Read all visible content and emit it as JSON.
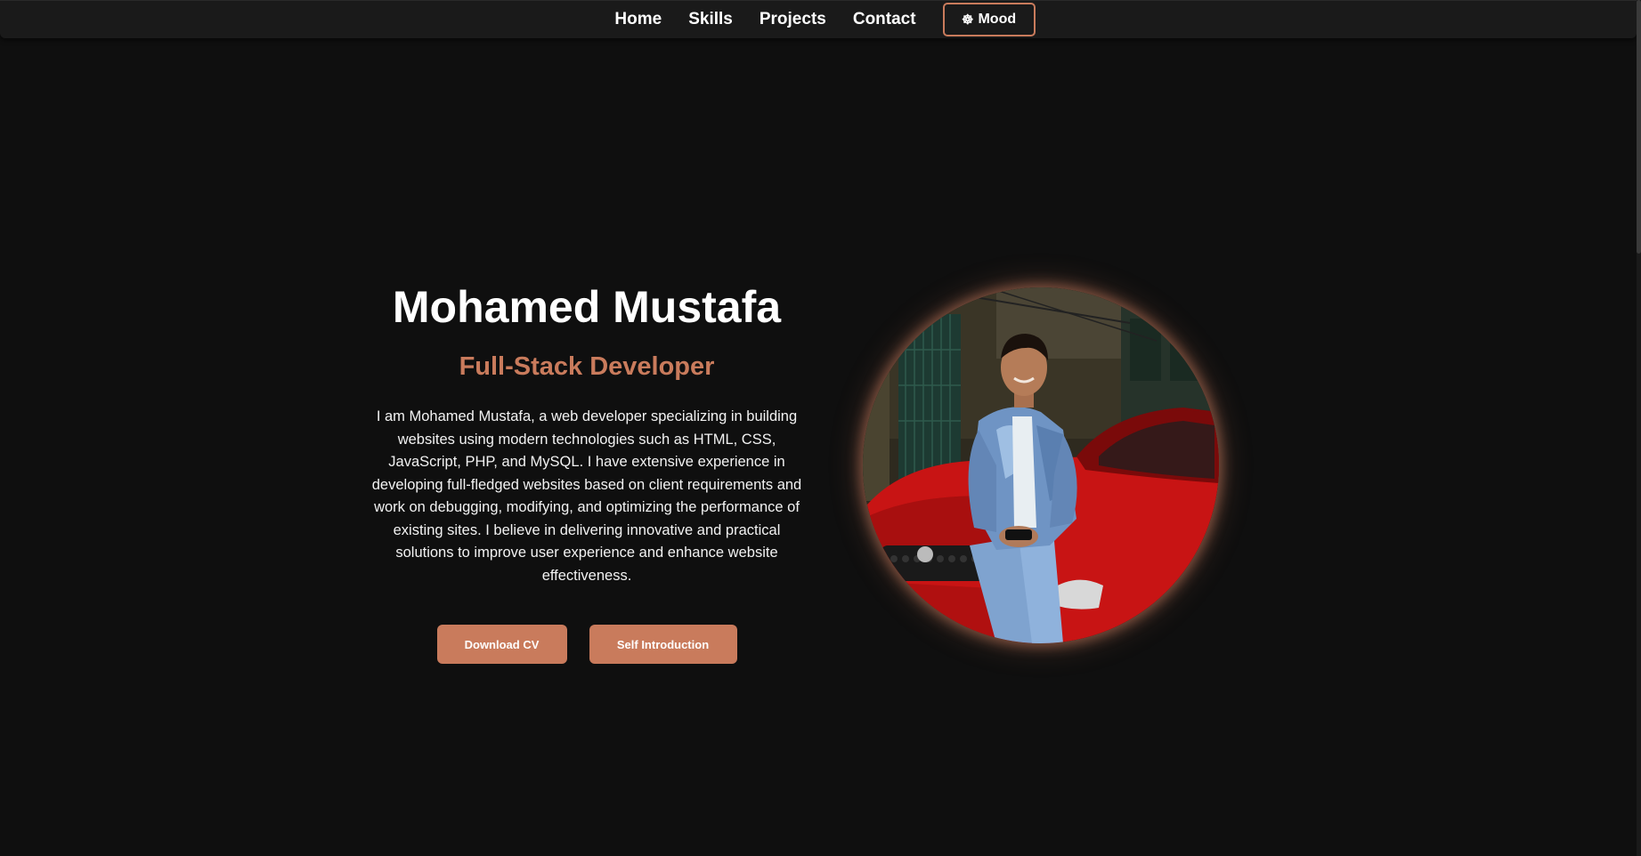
{
  "nav": {
    "items": [
      {
        "label": "Home"
      },
      {
        "label": "Skills"
      },
      {
        "label": "Projects"
      },
      {
        "label": "Contact"
      }
    ],
    "mood_icon": "☸",
    "mood_label": "Mood"
  },
  "hero": {
    "name": "Mohamed Mustafa",
    "role": "Full-Stack Developer",
    "bio": "I am Mohamed Mustafa, a web developer specializing in building websites using modern technologies such as HTML, CSS, JavaScript, PHP, and MySQL. I have extensive experience in developing full-fledged websites based on client requirements and work on debugging, modifying, and optimizing the performance of existing sites. I believe in delivering innovative and practical solutions to improve user experience and enhance website effectiveness.",
    "download_cv_label": "Download CV",
    "self_intro_label": "Self Introduction"
  },
  "colors": {
    "accent": "#c97b5c",
    "background": "#0f0f0f",
    "navbar": "#1a1a1a"
  }
}
